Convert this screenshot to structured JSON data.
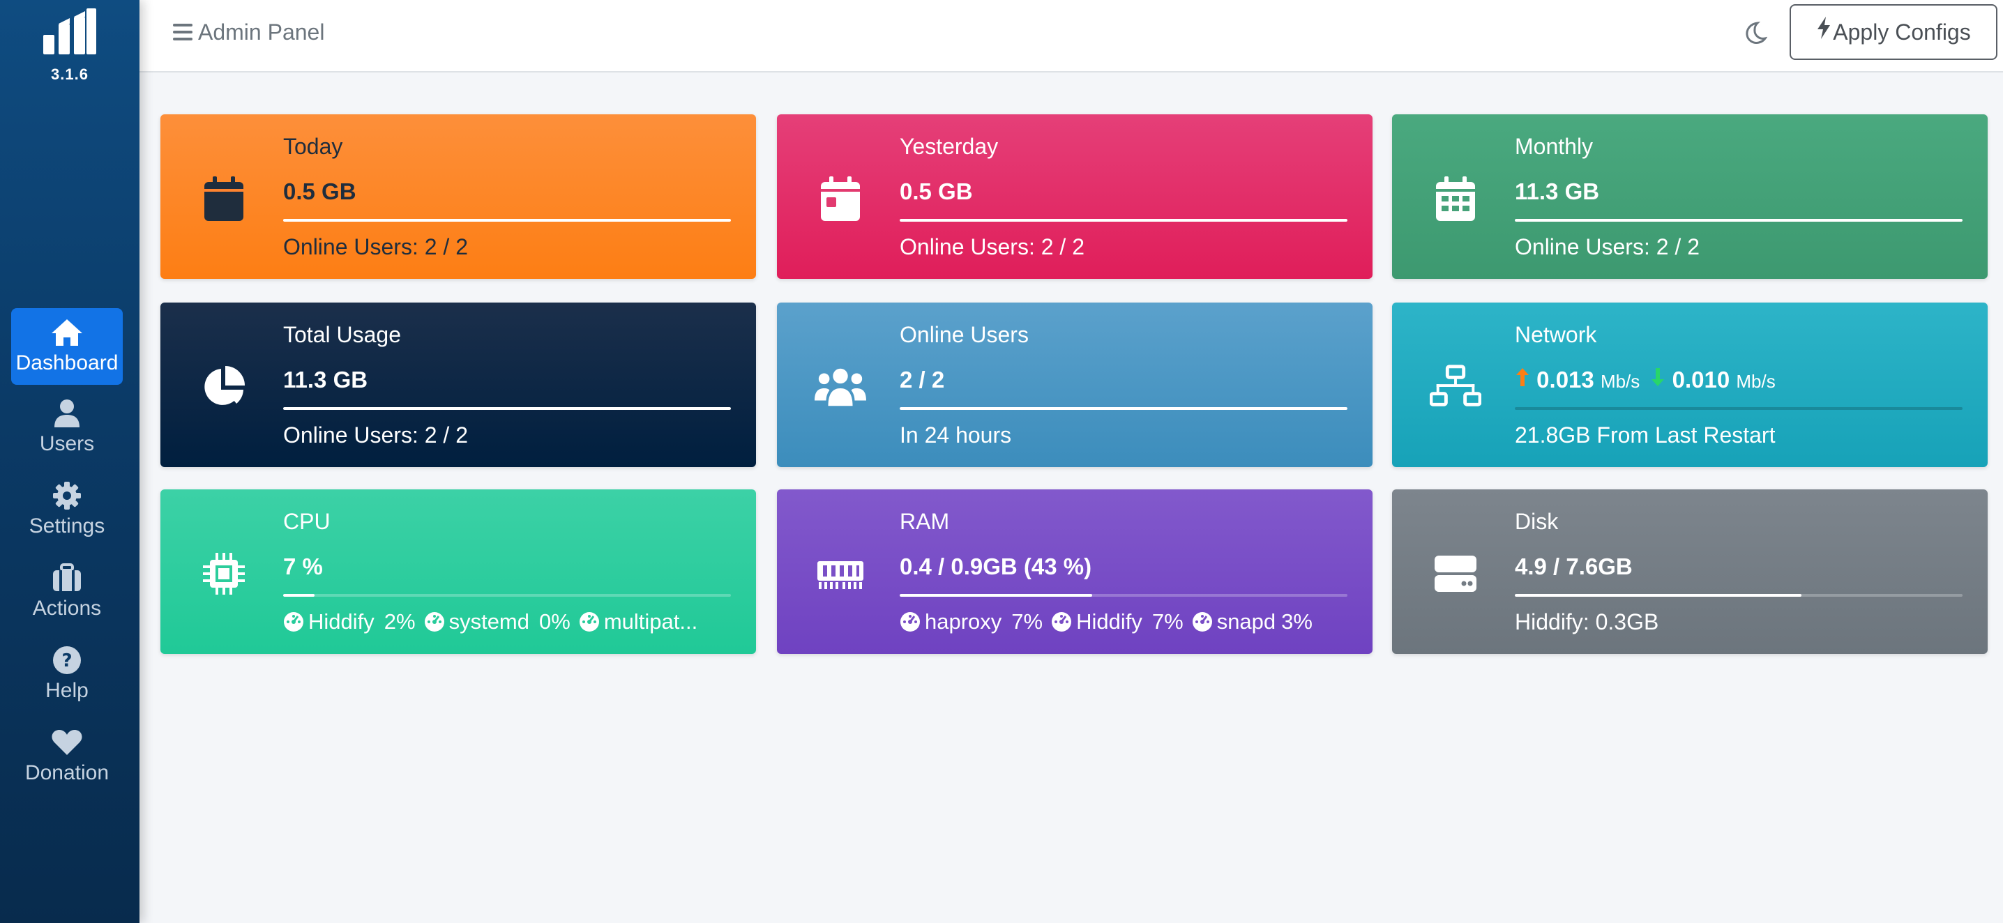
{
  "app": {
    "version": "3.1.6"
  },
  "sidebar": {
    "items": [
      {
        "label": "Dashboard",
        "icon": "home-icon",
        "active": true
      },
      {
        "label": "Users",
        "icon": "user-icon"
      },
      {
        "label": "Settings",
        "icon": "gear-icon"
      },
      {
        "label": "Actions",
        "icon": "briefcase-icon"
      },
      {
        "label": "Help",
        "icon": "question-circle-icon"
      },
      {
        "label": "Donation",
        "icon": "heart-icon"
      }
    ]
  },
  "header": {
    "title": "Admin Panel",
    "apply_label": "Apply Configs"
  },
  "cards": {
    "today": {
      "title": "Today",
      "value": "0.5 GB",
      "desc": "Online Users: 2 / 2",
      "color": "#fd7e14"
    },
    "yesterday": {
      "title": "Yesterday",
      "value": "0.5 GB",
      "desc": "Online Users: 2 / 2",
      "color": "#e83e8c"
    },
    "monthly": {
      "title": "Monthly",
      "value": "11.3 GB",
      "desc": "Online Users: 2 / 2",
      "color": "#3d9970"
    },
    "total": {
      "title": "Total Usage",
      "value": "11.3 GB",
      "desc": "Online Users: 2 / 2",
      "color": "#001f3f"
    },
    "online": {
      "title": "Online Users",
      "value": "2 / 2",
      "desc": "In 24 hours",
      "color": "#3c8dbc"
    },
    "network": {
      "title": "Network",
      "up_value": "0.013",
      "down_value": "0.010",
      "unit": "Mb/s",
      "desc": "21.8GB From Last Restart",
      "color": "#17a2b8"
    },
    "cpu": {
      "title": "CPU",
      "value": "7 %",
      "percent": 7,
      "color": "#20c997",
      "processes": [
        {
          "name": "Hiddify",
          "pct": "2%"
        },
        {
          "name": "systemd",
          "pct": "0%"
        },
        {
          "name": "multipat...",
          "pct": ""
        }
      ]
    },
    "ram": {
      "title": "RAM",
      "value": "0.4 / 0.9GB (43 %)",
      "percent": 43,
      "color": "#6f42c1",
      "processes": [
        {
          "name": "haproxy",
          "pct": "7%"
        },
        {
          "name": "Hiddify",
          "pct": "7%"
        },
        {
          "name": "snapd",
          "pct": "3%"
        }
      ]
    },
    "disk": {
      "title": "Disk",
      "value": "4.9 / 7.6GB",
      "percent": 64,
      "desc": "Hiddify: 0.3GB",
      "color": "#6c757d"
    }
  }
}
